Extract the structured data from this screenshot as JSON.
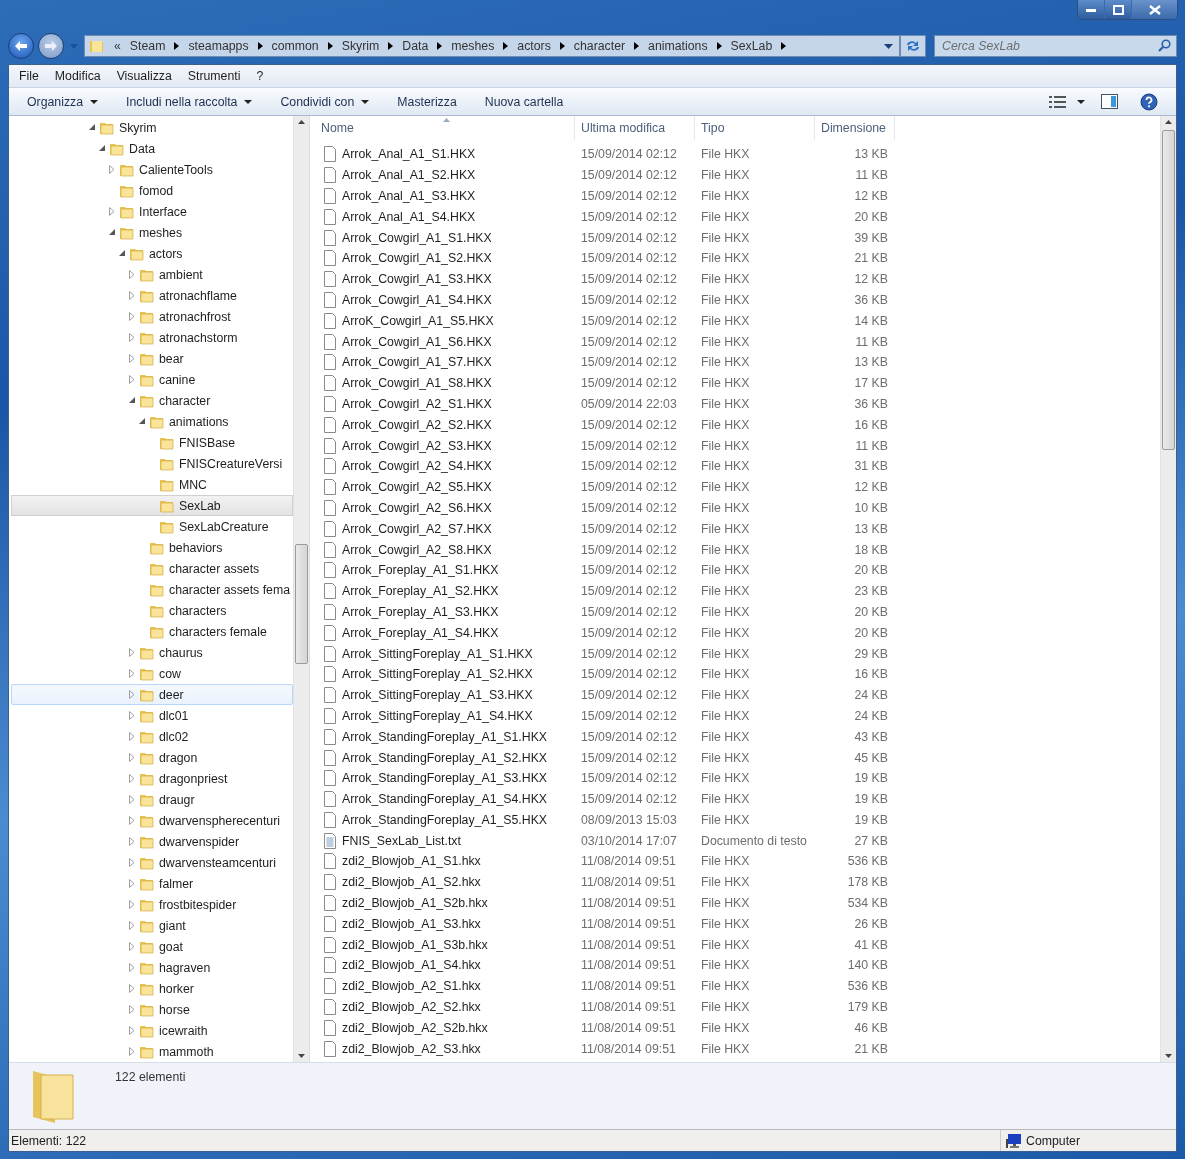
{
  "address": {
    "overflow": "«",
    "segments": [
      "Steam",
      "steamapps",
      "common",
      "Skyrim",
      "Data",
      "meshes",
      "actors",
      "character",
      "animations",
      "SexLab"
    ]
  },
  "search": {
    "placeholder": "Cerca SexLab"
  },
  "menu": [
    "File",
    "Modifica",
    "Visualizza",
    "Strumenti",
    "?"
  ],
  "toolbar": [
    {
      "label": "Organizza",
      "has_menu": true
    },
    {
      "label": "Includi nella raccolta",
      "has_menu": true
    },
    {
      "label": "Condividi con",
      "has_menu": true
    },
    {
      "label": "Masterizza",
      "has_menu": false
    },
    {
      "label": "Nuova cartella",
      "has_menu": false
    }
  ],
  "tree": [
    {
      "label": "Skyrim",
      "has_children": true,
      "expanded": true,
      "selected": false,
      "hovered": false,
      "children": [
        {
          "label": "Data",
          "has_children": true,
          "expanded": true,
          "selected": false,
          "hovered": false,
          "children": [
            {
              "label": "CalienteTools",
              "has_children": true,
              "expanded": false,
              "selected": false,
              "hovered": false
            },
            {
              "label": "fomod",
              "has_children": false,
              "expanded": false,
              "selected": false,
              "hovered": false
            },
            {
              "label": "Interface",
              "has_children": true,
              "expanded": false,
              "selected": false,
              "hovered": false
            },
            {
              "label": "meshes",
              "has_children": true,
              "expanded": true,
              "selected": false,
              "hovered": false,
              "children": [
                {
                  "label": "actors",
                  "has_children": true,
                  "expanded": true,
                  "selected": false,
                  "hovered": false,
                  "children": [
                    {
                      "label": "ambient",
                      "has_children": true,
                      "expanded": false,
                      "selected": false,
                      "hovered": false
                    },
                    {
                      "label": "atronachflame",
                      "has_children": true,
                      "expanded": false,
                      "selected": false,
                      "hovered": false
                    },
                    {
                      "label": "atronachfrost",
                      "has_children": true,
                      "expanded": false,
                      "selected": false,
                      "hovered": false
                    },
                    {
                      "label": "atronachstorm",
                      "has_children": true,
                      "expanded": false,
                      "selected": false,
                      "hovered": false
                    },
                    {
                      "label": "bear",
                      "has_children": true,
                      "expanded": false,
                      "selected": false,
                      "hovered": false
                    },
                    {
                      "label": "canine",
                      "has_children": true,
                      "expanded": false,
                      "selected": false,
                      "hovered": false
                    },
                    {
                      "label": "character",
                      "has_children": true,
                      "expanded": true,
                      "selected": false,
                      "hovered": false,
                      "children": [
                        {
                          "label": "animations",
                          "has_children": true,
                          "expanded": true,
                          "selected": false,
                          "hovered": false,
                          "children": [
                            {
                              "label": "FNISBase",
                              "has_children": false,
                              "expanded": false,
                              "selected": false,
                              "hovered": false
                            },
                            {
                              "label": "FNISCreatureVersi",
                              "has_children": false,
                              "expanded": false,
                              "selected": false,
                              "hovered": false
                            },
                            {
                              "label": "MNC",
                              "has_children": false,
                              "expanded": false,
                              "selected": false,
                              "hovered": false
                            },
                            {
                              "label": "SexLab",
                              "has_children": false,
                              "expanded": false,
                              "selected": true,
                              "hovered": false
                            },
                            {
                              "label": "SexLabCreature",
                              "has_children": false,
                              "expanded": false,
                              "selected": false,
                              "hovered": false
                            }
                          ]
                        },
                        {
                          "label": "behaviors",
                          "has_children": false,
                          "expanded": false,
                          "selected": false,
                          "hovered": false
                        },
                        {
                          "label": "character assets",
                          "has_children": false,
                          "expanded": false,
                          "selected": false,
                          "hovered": false
                        },
                        {
                          "label": "character assets fema",
                          "has_children": false,
                          "expanded": false,
                          "selected": false,
                          "hovered": false
                        },
                        {
                          "label": "characters",
                          "has_children": false,
                          "expanded": false,
                          "selected": false,
                          "hovered": false
                        },
                        {
                          "label": "characters female",
                          "has_children": false,
                          "expanded": false,
                          "selected": false,
                          "hovered": false
                        }
                      ]
                    },
                    {
                      "label": "chaurus",
                      "has_children": true,
                      "expanded": false,
                      "selected": false,
                      "hovered": false
                    },
                    {
                      "label": "cow",
                      "has_children": true,
                      "expanded": false,
                      "selected": false,
                      "hovered": false
                    },
                    {
                      "label": "deer",
                      "has_children": true,
                      "expanded": false,
                      "selected": false,
                      "hovered": true
                    },
                    {
                      "label": "dlc01",
                      "has_children": true,
                      "expanded": false,
                      "selected": false,
                      "hovered": false
                    },
                    {
                      "label": "dlc02",
                      "has_children": true,
                      "expanded": false,
                      "selected": false,
                      "hovered": false
                    },
                    {
                      "label": "dragon",
                      "has_children": true,
                      "expanded": false,
                      "selected": false,
                      "hovered": false
                    },
                    {
                      "label": "dragonpriest",
                      "has_children": true,
                      "expanded": false,
                      "selected": false,
                      "hovered": false
                    },
                    {
                      "label": "draugr",
                      "has_children": true,
                      "expanded": false,
                      "selected": false,
                      "hovered": false
                    },
                    {
                      "label": "dwarvenspherecenturi",
                      "has_children": true,
                      "expanded": false,
                      "selected": false,
                      "hovered": false
                    },
                    {
                      "label": "dwarvenspider",
                      "has_children": true,
                      "expanded": false,
                      "selected": false,
                      "hovered": false
                    },
                    {
                      "label": "dwarvensteamcenturi",
                      "has_children": true,
                      "expanded": false,
                      "selected": false,
                      "hovered": false
                    },
                    {
                      "label": "falmer",
                      "has_children": true,
                      "expanded": false,
                      "selected": false,
                      "hovered": false
                    },
                    {
                      "label": "frostbitespider",
                      "has_children": true,
                      "expanded": false,
                      "selected": false,
                      "hovered": false
                    },
                    {
                      "label": "giant",
                      "has_children": true,
                      "expanded": false,
                      "selected": false,
                      "hovered": false
                    },
                    {
                      "label": "goat",
                      "has_children": true,
                      "expanded": false,
                      "selected": false,
                      "hovered": false
                    },
                    {
                      "label": "hagraven",
                      "has_children": true,
                      "expanded": false,
                      "selected": false,
                      "hovered": false
                    },
                    {
                      "label": "horker",
                      "has_children": true,
                      "expanded": false,
                      "selected": false,
                      "hovered": false
                    },
                    {
                      "label": "horse",
                      "has_children": true,
                      "expanded": false,
                      "selected": false,
                      "hovered": false
                    },
                    {
                      "label": "icewraith",
                      "has_children": true,
                      "expanded": false,
                      "selected": false,
                      "hovered": false
                    },
                    {
                      "label": "mammoth",
                      "has_children": true,
                      "expanded": false,
                      "selected": false,
                      "hovered": false
                    }
                  ]
                }
              ]
            }
          ]
        }
      ]
    }
  ],
  "table": {
    "columns": [
      "Nome",
      "Ultima modifica",
      "Tipo",
      "Dimensione"
    ],
    "rows": [
      {
        "kind": "hkx",
        "name": "Arrok_Anal_A1_S1.HKX",
        "modified": "15/09/2014 02:12",
        "type": "File HKX",
        "size": "13 KB"
      },
      {
        "kind": "hkx",
        "name": "Arrok_Anal_A1_S2.HKX",
        "modified": "15/09/2014 02:12",
        "type": "File HKX",
        "size": "11 KB"
      },
      {
        "kind": "hkx",
        "name": "Arrok_Anal_A1_S3.HKX",
        "modified": "15/09/2014 02:12",
        "type": "File HKX",
        "size": "12 KB"
      },
      {
        "kind": "hkx",
        "name": "Arrok_Anal_A1_S4.HKX",
        "modified": "15/09/2014 02:12",
        "type": "File HKX",
        "size": "20 KB"
      },
      {
        "kind": "hkx",
        "name": "Arrok_Cowgirl_A1_S1.HKX",
        "modified": "15/09/2014 02:12",
        "type": "File HKX",
        "size": "39 KB"
      },
      {
        "kind": "hkx",
        "name": "Arrok_Cowgirl_A1_S2.HKX",
        "modified": "15/09/2014 02:12",
        "type": "File HKX",
        "size": "21 KB"
      },
      {
        "kind": "hkx",
        "name": "Arrok_Cowgirl_A1_S3.HKX",
        "modified": "15/09/2014 02:12",
        "type": "File HKX",
        "size": "12 KB"
      },
      {
        "kind": "hkx",
        "name": "Arrok_Cowgirl_A1_S4.HKX",
        "modified": "15/09/2014 02:12",
        "type": "File HKX",
        "size": "36 KB"
      },
      {
        "kind": "hkx",
        "name": "ArroK_Cowgirl_A1_S5.HKX",
        "modified": "15/09/2014 02:12",
        "type": "File HKX",
        "size": "14 KB"
      },
      {
        "kind": "hkx",
        "name": "Arrok_Cowgirl_A1_S6.HKX",
        "modified": "15/09/2014 02:12",
        "type": "File HKX",
        "size": "11 KB"
      },
      {
        "kind": "hkx",
        "name": "Arrok_Cowgirl_A1_S7.HKX",
        "modified": "15/09/2014 02:12",
        "type": "File HKX",
        "size": "13 KB"
      },
      {
        "kind": "hkx",
        "name": "Arrok_Cowgirl_A1_S8.HKX",
        "modified": "15/09/2014 02:12",
        "type": "File HKX",
        "size": "17 KB"
      },
      {
        "kind": "hkx",
        "name": "Arrok_Cowgirl_A2_S1.HKX",
        "modified": "05/09/2014 22:03",
        "type": "File HKX",
        "size": "36 KB"
      },
      {
        "kind": "hkx",
        "name": "Arrok_Cowgirl_A2_S2.HKX",
        "modified": "15/09/2014 02:12",
        "type": "File HKX",
        "size": "16 KB"
      },
      {
        "kind": "hkx",
        "name": "Arrok_Cowgirl_A2_S3.HKX",
        "modified": "15/09/2014 02:12",
        "type": "File HKX",
        "size": "11 KB"
      },
      {
        "kind": "hkx",
        "name": "Arrok_Cowgirl_A2_S4.HKX",
        "modified": "15/09/2014 02:12",
        "type": "File HKX",
        "size": "31 KB"
      },
      {
        "kind": "hkx",
        "name": "Arrok_Cowgirl_A2_S5.HKX",
        "modified": "15/09/2014 02:12",
        "type": "File HKX",
        "size": "12 KB"
      },
      {
        "kind": "hkx",
        "name": "Arrok_Cowgirl_A2_S6.HKX",
        "modified": "15/09/2014 02:12",
        "type": "File HKX",
        "size": "10 KB"
      },
      {
        "kind": "hkx",
        "name": "Arrok_Cowgirl_A2_S7.HKX",
        "modified": "15/09/2014 02:12",
        "type": "File HKX",
        "size": "13 KB"
      },
      {
        "kind": "hkx",
        "name": "Arrok_Cowgirl_A2_S8.HKX",
        "modified": "15/09/2014 02:12",
        "type": "File HKX",
        "size": "18 KB"
      },
      {
        "kind": "hkx",
        "name": "Arrok_Foreplay_A1_S1.HKX",
        "modified": "15/09/2014 02:12",
        "type": "File HKX",
        "size": "20 KB"
      },
      {
        "kind": "hkx",
        "name": "Arrok_Foreplay_A1_S2.HKX",
        "modified": "15/09/2014 02:12",
        "type": "File HKX",
        "size": "23 KB"
      },
      {
        "kind": "hkx",
        "name": "Arrok_Foreplay_A1_S3.HKX",
        "modified": "15/09/2014 02:12",
        "type": "File HKX",
        "size": "20 KB"
      },
      {
        "kind": "hkx",
        "name": "Arrok_Foreplay_A1_S4.HKX",
        "modified": "15/09/2014 02:12",
        "type": "File HKX",
        "size": "20 KB"
      },
      {
        "kind": "hkx",
        "name": "Arrok_SittingForeplay_A1_S1.HKX",
        "modified": "15/09/2014 02:12",
        "type": "File HKX",
        "size": "29 KB"
      },
      {
        "kind": "hkx",
        "name": "Arrok_SittingForeplay_A1_S2.HKX",
        "modified": "15/09/2014 02:12",
        "type": "File HKX",
        "size": "16 KB"
      },
      {
        "kind": "hkx",
        "name": "Arrok_SittingForeplay_A1_S3.HKX",
        "modified": "15/09/2014 02:12",
        "type": "File HKX",
        "size": "24 KB"
      },
      {
        "kind": "hkx",
        "name": "Arrok_SittingForeplay_A1_S4.HKX",
        "modified": "15/09/2014 02:12",
        "type": "File HKX",
        "size": "24 KB"
      },
      {
        "kind": "hkx",
        "name": "Arrok_StandingForeplay_A1_S1.HKX",
        "modified": "15/09/2014 02:12",
        "type": "File HKX",
        "size": "43 KB"
      },
      {
        "kind": "hkx",
        "name": "Arrok_StandingForeplay_A1_S2.HKX",
        "modified": "15/09/2014 02:12",
        "type": "File HKX",
        "size": "45 KB"
      },
      {
        "kind": "hkx",
        "name": "Arrok_StandingForeplay_A1_S3.HKX",
        "modified": "15/09/2014 02:12",
        "type": "File HKX",
        "size": "19 KB"
      },
      {
        "kind": "hkx",
        "name": "Arrok_StandingForeplay_A1_S4.HKX",
        "modified": "15/09/2014 02:12",
        "type": "File HKX",
        "size": "19 KB"
      },
      {
        "kind": "hkx",
        "name": "Arrok_StandingForeplay_A1_S5.HKX",
        "modified": "08/09/2013 15:03",
        "type": "File HKX",
        "size": "19 KB"
      },
      {
        "kind": "text",
        "name": "FNIS_SexLab_List.txt",
        "modified": "03/10/2014 17:07",
        "type": "Documento di testo",
        "size": "27 KB"
      },
      {
        "kind": "hkx",
        "name": "zdi2_Blowjob_A1_S1.hkx",
        "modified": "11/08/2014 09:51",
        "type": "File HKX",
        "size": "536 KB"
      },
      {
        "kind": "hkx",
        "name": "zdi2_Blowjob_A1_S2.hkx",
        "modified": "11/08/2014 09:51",
        "type": "File HKX",
        "size": "178 KB"
      },
      {
        "kind": "hkx",
        "name": "zdi2_Blowjob_A1_S2b.hkx",
        "modified": "11/08/2014 09:51",
        "type": "File HKX",
        "size": "534 KB"
      },
      {
        "kind": "hkx",
        "name": "zdi2_Blowjob_A1_S3.hkx",
        "modified": "11/08/2014 09:51",
        "type": "File HKX",
        "size": "26 KB"
      },
      {
        "kind": "hkx",
        "name": "zdi2_Blowjob_A1_S3b.hkx",
        "modified": "11/08/2014 09:51",
        "type": "File HKX",
        "size": "41 KB"
      },
      {
        "kind": "hkx",
        "name": "zdi2_Blowjob_A1_S4.hkx",
        "modified": "11/08/2014 09:51",
        "type": "File HKX",
        "size": "140 KB"
      },
      {
        "kind": "hkx",
        "name": "zdi2_Blowjob_A2_S1.hkx",
        "modified": "11/08/2014 09:51",
        "type": "File HKX",
        "size": "536 KB"
      },
      {
        "kind": "hkx",
        "name": "zdi2_Blowjob_A2_S2.hkx",
        "modified": "11/08/2014 09:51",
        "type": "File HKX",
        "size": "179 KB"
      },
      {
        "kind": "hkx",
        "name": "zdi2_Blowjob_A2_S2b.hkx",
        "modified": "11/08/2014 09:51",
        "type": "File HKX",
        "size": "46 KB"
      },
      {
        "kind": "hkx",
        "name": "zdi2_Blowjob_A2_S3.hkx",
        "modified": "11/08/2014 09:51",
        "type": "File HKX",
        "size": "21 KB"
      }
    ]
  },
  "details": {
    "count": "122 elementi"
  },
  "status_bar": {
    "items": "Elementi: 122",
    "location": "Computer"
  }
}
